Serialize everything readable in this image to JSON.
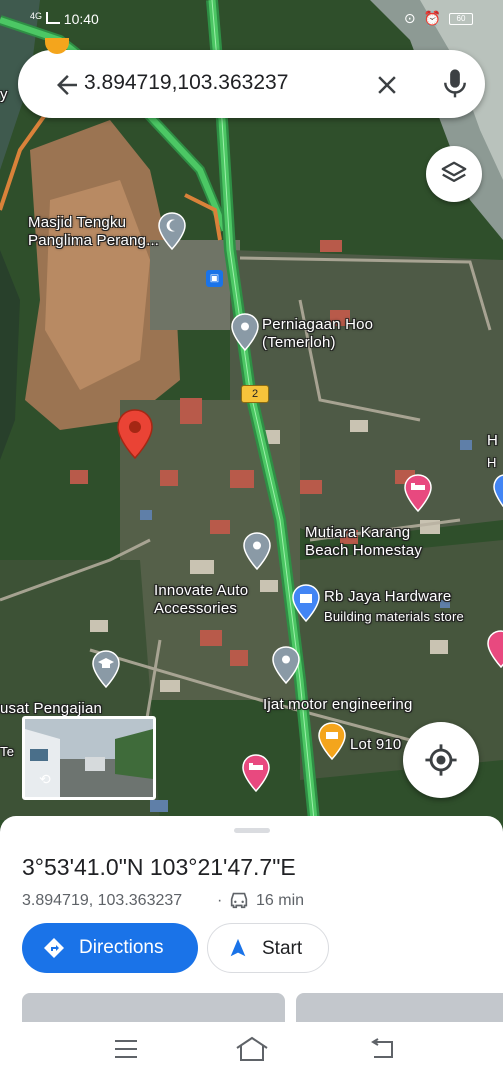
{
  "status_bar": {
    "network": "4G",
    "time": "10:40",
    "battery": "60"
  },
  "search": {
    "query": "3.894719,103.363237",
    "back_icon": "arrow-back-icon",
    "clear_icon": "close-icon",
    "mic_icon": "microphone-icon"
  },
  "map": {
    "labels": {
      "masjid": "Masjid Tengku\nPanglima Perang...",
      "perniagaan": "Perniagaan Hoo\n(Temerloh)",
      "mutiara": "Mutiara Karang\nBeach Homestay",
      "innovate": "Innovate Auto\nAccessories",
      "rbjaya": "Rb Jaya Hardware",
      "rbjaya_sub": "Building materials store",
      "ijat": "Ijat motor engineering",
      "lot": "Lot 910",
      "pusat": "usat Pengajian",
      "pusat_sub": "Te",
      "edge_h1": "H",
      "edge_h2": "H",
      "edge_left": "y"
    },
    "route_shield": "2",
    "colors": {
      "road_green": "#4cc764",
      "road_edge": "#2f8f45",
      "pin_red": "#ea4335",
      "pin_grey": "#8a9aa6",
      "pin_pink": "#e8497f",
      "pin_blue": "#4285f4",
      "pin_orange": "#f4a51c"
    }
  },
  "sheet": {
    "title": "3°53'41.0\"N 103°21'47.7\"E",
    "coords": "3.894719, 103.363237",
    "separator": "·",
    "duration": "16 min",
    "directions_label": "Directions",
    "start_label": "Start"
  },
  "nav": {
    "menu_icon": "menu-icon",
    "home_icon": "home-icon",
    "back_icon": "back-icon"
  }
}
